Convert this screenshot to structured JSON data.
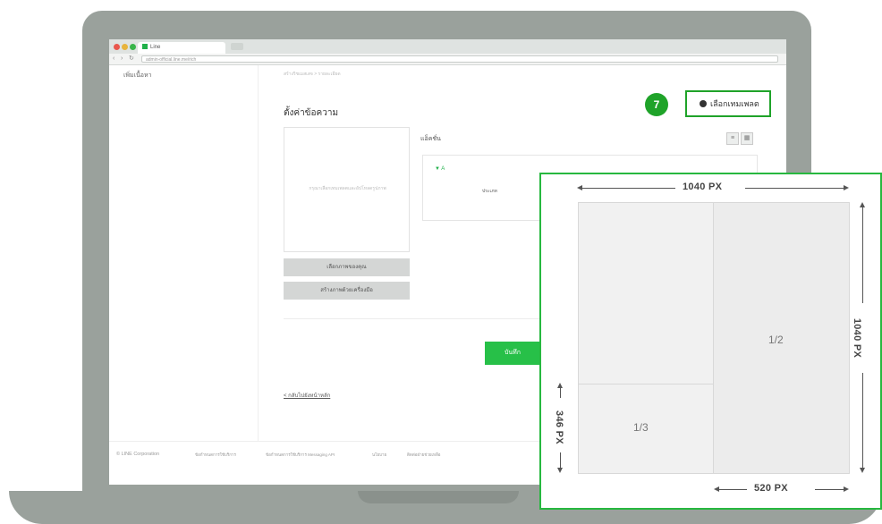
{
  "browser": {
    "tab_title": "Line",
    "url": "admin-official.line.me/rich"
  },
  "nav": {
    "back": "‹",
    "forward": "›",
    "reload": "↻"
  },
  "sidebar": {
    "label": "เพิ่มเนื้อหา"
  },
  "main": {
    "breadcrumb": "สร้างริชเมสเสจ > รายละเอียด",
    "section_title": "ตั้งค่าข้อความ",
    "step_number": "7",
    "template_button": "เลือกเทมเพลต",
    "image_placeholder": "กรุณาเลือกเทมเพลตและอัปโหลดรูปภาพ",
    "upload_button": "เลือกภาพของคุณ",
    "create_button": "สร้างภาพด้วยเครื่องมือ",
    "layout_label": "แอ็คชั่น",
    "view_list_icon": "≡",
    "view_grid_icon": "▦",
    "card_tag": "▼ A",
    "card_type_label": "ประเภท",
    "save_button": "บันทึก",
    "back_link": "< กลับไปยังหน้าหลัก"
  },
  "footer": {
    "copyright": "© LINE Corporation",
    "links": [
      "ข้อกำหนดการใช้บริการ",
      "ข้อกำหนดการใช้บริการ Messaging API",
      "นโยบาย",
      "ติดต่อฝ่ายช่วยเหลือ"
    ]
  },
  "zoom_panel": {
    "width_label": "1040 PX",
    "height_label": "1040 PX",
    "small_height_label": "346 PX",
    "half_width_label": "520 PX",
    "tile_half": "1/2",
    "tile_third": "1/3",
    "border_color": "#27b83f"
  },
  "colors": {
    "accent": "#1fa329",
    "save": "#27c048",
    "laptop": "#9aa19c"
  }
}
